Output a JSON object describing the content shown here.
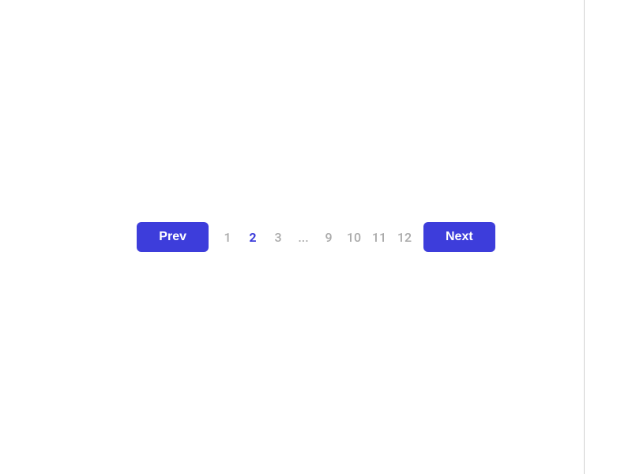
{
  "pagination": {
    "prev_label": "Prev",
    "next_label": "Next",
    "pages": [
      {
        "value": "1",
        "active": false,
        "ellipsis": false
      },
      {
        "value": "2",
        "active": true,
        "ellipsis": false
      },
      {
        "value": "3",
        "active": false,
        "ellipsis": false
      },
      {
        "value": "...",
        "active": false,
        "ellipsis": true
      },
      {
        "value": "9",
        "active": false,
        "ellipsis": false
      },
      {
        "value": "10",
        "active": false,
        "ellipsis": false
      },
      {
        "value": "11",
        "active": false,
        "ellipsis": false
      },
      {
        "value": "12",
        "active": false,
        "ellipsis": false
      }
    ]
  },
  "colors": {
    "accent": "#3d3ddb",
    "text_inactive": "#aaaaaa",
    "divider": "#d0d0d0"
  }
}
